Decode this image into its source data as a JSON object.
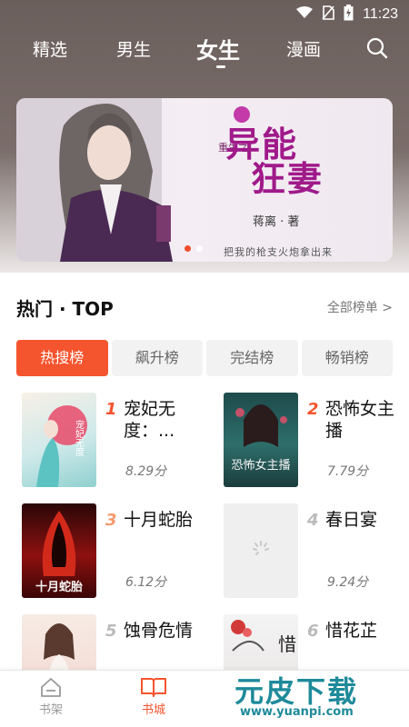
{
  "status_bar": {
    "time": "11:23"
  },
  "top_nav": {
    "tabs": [
      {
        "label": "精选"
      },
      {
        "label": "男生"
      },
      {
        "label": "女生"
      },
      {
        "label": "漫画"
      }
    ],
    "active_tab": "女生"
  },
  "banner": {
    "title_line1": "异能",
    "title_line2": "狂妻",
    "prefix": "重生之",
    "author": "蒋离 · 著",
    "slogan": "把我的枪支火炮拿出来"
  },
  "section": {
    "title": "热门 · TOP",
    "more_label": "全部榜单 >"
  },
  "rank_tabs": [
    {
      "label": "热搜榜",
      "active": true
    },
    {
      "label": "飙升榜",
      "active": false
    },
    {
      "label": "完结榜",
      "active": false
    },
    {
      "label": "畅销榜",
      "active": false
    }
  ],
  "books": [
    {
      "rank": "1",
      "title": "宠妃无度：...",
      "score": "8.29分",
      "rank_color": "#f4542e"
    },
    {
      "rank": "2",
      "title": "恐怖女主播",
      "score": "7.79分",
      "rank_color": "#f4542e"
    },
    {
      "rank": "3",
      "title": "十月蛇胎",
      "score": "6.12分",
      "rank_color": "#f59a6e"
    },
    {
      "rank": "4",
      "title": "春日宴",
      "score": "9.24分",
      "rank_color": "#bbbbbb"
    },
    {
      "rank": "5",
      "title": "蚀骨危情",
      "score": "",
      "rank_color": "#bbbbbb"
    },
    {
      "rank": "6",
      "title": "惜花芷",
      "score": "",
      "rank_color": "#bbbbbb"
    }
  ],
  "cover_text": {
    "book1": "宠妃无度",
    "book2": "恐怖女主播",
    "book3": "十月蛇胎",
    "book6": "惜"
  },
  "bottom_nav": [
    {
      "label": "书架",
      "active": false
    },
    {
      "label": "书城",
      "active": true
    }
  ],
  "watermark": {
    "text": "元皮下载",
    "url": "www.yuanpi.com"
  },
  "colors": {
    "accent": "#f4542e",
    "banner_title": "#a01a8a"
  }
}
